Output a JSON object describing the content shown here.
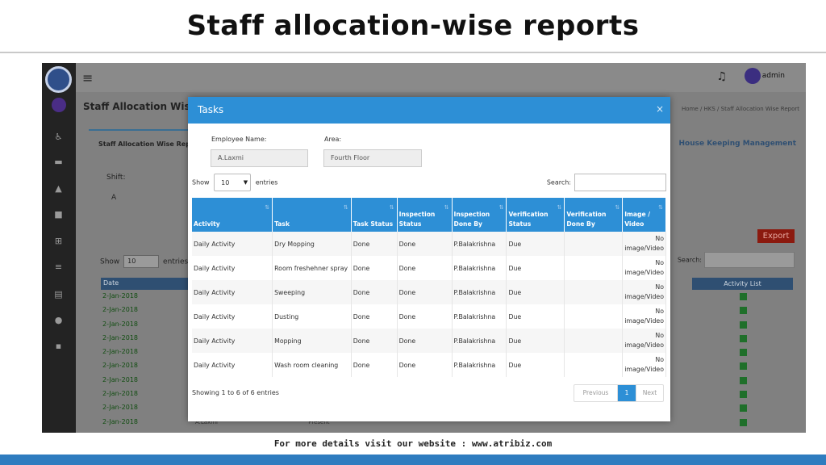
{
  "slide": {
    "title": "Staff allocation-wise reports",
    "footer": "For more details visit our website : www.atribiz.com"
  },
  "background_app": {
    "admin_label": "admin",
    "page_title": "Staff Allocation Wise R",
    "panel_title": "Staff Allocation Wise Report",
    "breadcrumb": "Home  /  HKS  /  Staff Allocation Wise Report",
    "module_link": "House Keeping Management",
    "shift_label": "Shift:",
    "shift_value": "A",
    "show_label": "Show",
    "show_value": "10",
    "entries_label": "entries",
    "export_label": "Export",
    "search_label": "Search:",
    "date_header": "Date",
    "activity_list_header": "Activity List",
    "dates": [
      "2-Jan-2018",
      "2-Jan-2018",
      "2-Jan-2018",
      "2-Jan-2018",
      "2-Jan-2018",
      "2-Jan-2018",
      "2-Jan-2018",
      "2-Jan-2018",
      "2-Jan-2018",
      "2-Jan-2018"
    ],
    "last_row_name": "A.Laxmi",
    "last_row_status": "Present"
  },
  "modal": {
    "title": "Tasks",
    "close": "×",
    "employee_label": "Employee Name:",
    "employee_value": "A.Laxmi",
    "area_label": "Area:",
    "area_value": "Fourth Floor",
    "show_label": "Show",
    "show_value": "10",
    "entries_label": "entries",
    "search_label": "Search:",
    "columns": [
      "Activity",
      "Task",
      "Task Status",
      "Inspection Status",
      "Inspection Done By",
      "Verification Status",
      "Verification Done By",
      "Image / Video"
    ],
    "rows": [
      {
        "activity": "Daily Activity",
        "task": "Dry Mopping",
        "task_status": "Done",
        "inspection_status": "Done",
        "inspection_by": "P.Balakrishna",
        "verification_status": "Due",
        "verification_by": "",
        "image": "No image/Video"
      },
      {
        "activity": "Daily Activity",
        "task": "Room freshehner spray",
        "task_status": "Done",
        "inspection_status": "Done",
        "inspection_by": "P.Balakrishna",
        "verification_status": "Due",
        "verification_by": "",
        "image": "No image/Video"
      },
      {
        "activity": "Daily Activity",
        "task": "Sweeping",
        "task_status": "Done",
        "inspection_status": "Done",
        "inspection_by": "P.Balakrishna",
        "verification_status": "Due",
        "verification_by": "",
        "image": "No image/Video"
      },
      {
        "activity": "Daily Activity",
        "task": "Dusting",
        "task_status": "Done",
        "inspection_status": "Done",
        "inspection_by": "P.Balakrishna",
        "verification_status": "Due",
        "verification_by": "",
        "image": "No image/Video"
      },
      {
        "activity": "Daily Activity",
        "task": "Mopping",
        "task_status": "Done",
        "inspection_status": "Done",
        "inspection_by": "P.Balakrishna",
        "verification_status": "Due",
        "verification_by": "",
        "image": "No image/Video"
      },
      {
        "activity": "Daily Activity",
        "task": "Wash room cleaning",
        "task_status": "Done",
        "inspection_status": "Done",
        "inspection_by": "P.Balakrishna",
        "verification_status": "Due",
        "verification_by": "",
        "image": "No image/Video"
      }
    ],
    "info": "Showing 1 to 6 of 6 entries",
    "pager": {
      "previous": "Previous",
      "current": "1",
      "next": "Next"
    }
  },
  "colors": {
    "modal_header": "#2d8fd6",
    "table_header": "#2d8fd6",
    "bottom_bar": "#2e7cbf"
  }
}
